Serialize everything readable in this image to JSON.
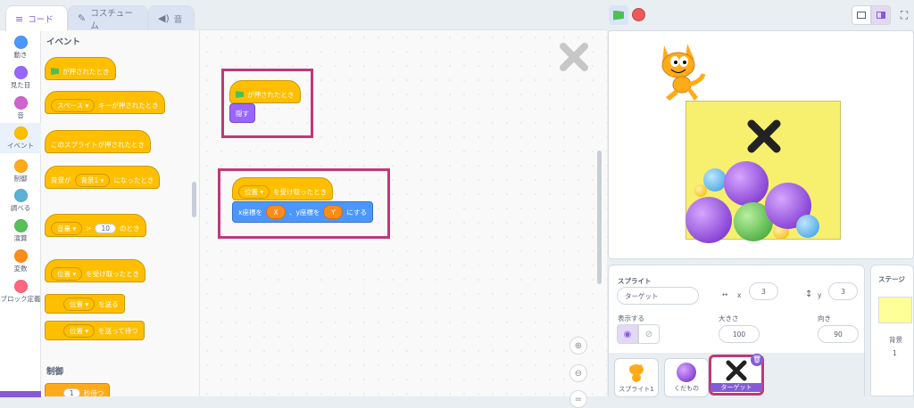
{
  "tabs": [
    {
      "label": "コード",
      "icon": "code-icon"
    },
    {
      "label": "コスチューム",
      "icon": "brush-icon"
    },
    {
      "label": "音",
      "icon": "speaker-icon"
    }
  ],
  "categories": [
    {
      "label": "動き",
      "color": "#4c97ff"
    },
    {
      "label": "見た目",
      "color": "#9966ff"
    },
    {
      "label": "音",
      "color": "#cf63cf"
    },
    {
      "label": "イベント",
      "color": "#ffbf00"
    },
    {
      "label": "制御",
      "color": "#ffab19"
    },
    {
      "label": "調べる",
      "color": "#5cb1d6"
    },
    {
      "label": "演算",
      "color": "#59c059"
    },
    {
      "label": "変数",
      "color": "#ff8c1a"
    },
    {
      "label": "ブロック定義",
      "color": "#ff6680"
    }
  ],
  "palette": {
    "events_heading": "イベント",
    "flag_clicked": "が押されたとき",
    "key_dropdown": "スペース",
    "key_pressed": "キーが押されたとき",
    "sprite_clicked": "このスプライトが押されたとき",
    "backdrop_prefix": "背景が",
    "backdrop_dropdown": "背景1",
    "backdrop_suffix": "になったとき",
    "volume_dropdown": "音量",
    "gt": ">",
    "volume_value": "10",
    "volume_suffix": "のとき",
    "receive_dropdown": "位置",
    "receive_label": "を受け取ったとき",
    "broadcast_dropdown": "位置",
    "broadcast_label": "を送る",
    "broadcast_wait_dropdown": "位置",
    "broadcast_wait_label": "を送って待つ",
    "control_heading": "制御",
    "wait_value": "1",
    "wait_label": "秒待つ"
  },
  "script1": {
    "flag_label": "が押されたとき",
    "hide_label": "隠す"
  },
  "script2": {
    "receive_dropdown": "位置",
    "receive_label": "を受け取ったとき",
    "goto_x_label": "x座標を",
    "x_value": "X",
    "goto_y_label": "、y座標を",
    "y_value": "Y",
    "goto_suffix": "にする"
  },
  "sprite_panel": {
    "sprite_label": "スプライト",
    "sprite_name": "ターゲット",
    "x_label": "x",
    "x_value": "3",
    "y_label": "y",
    "y_value": "3",
    "show_label": "表示する",
    "size_label": "大きさ",
    "size_value": "100",
    "direction_label": "向き",
    "direction_value": "90"
  },
  "sprites": [
    {
      "name": "スプライト1"
    },
    {
      "name": "くだもの"
    },
    {
      "name": "ターゲット"
    }
  ],
  "stage_panel": {
    "title": "ステージ",
    "backdrop_label": "背景",
    "backdrop_count": "1"
  },
  "colors": {
    "accent": "#855cd6",
    "highlight_frame": "#c2377a",
    "events": "#ffbf00",
    "motion": "#4c97ff",
    "looks": "#9966ff",
    "variables": "#ff8c1a"
  }
}
